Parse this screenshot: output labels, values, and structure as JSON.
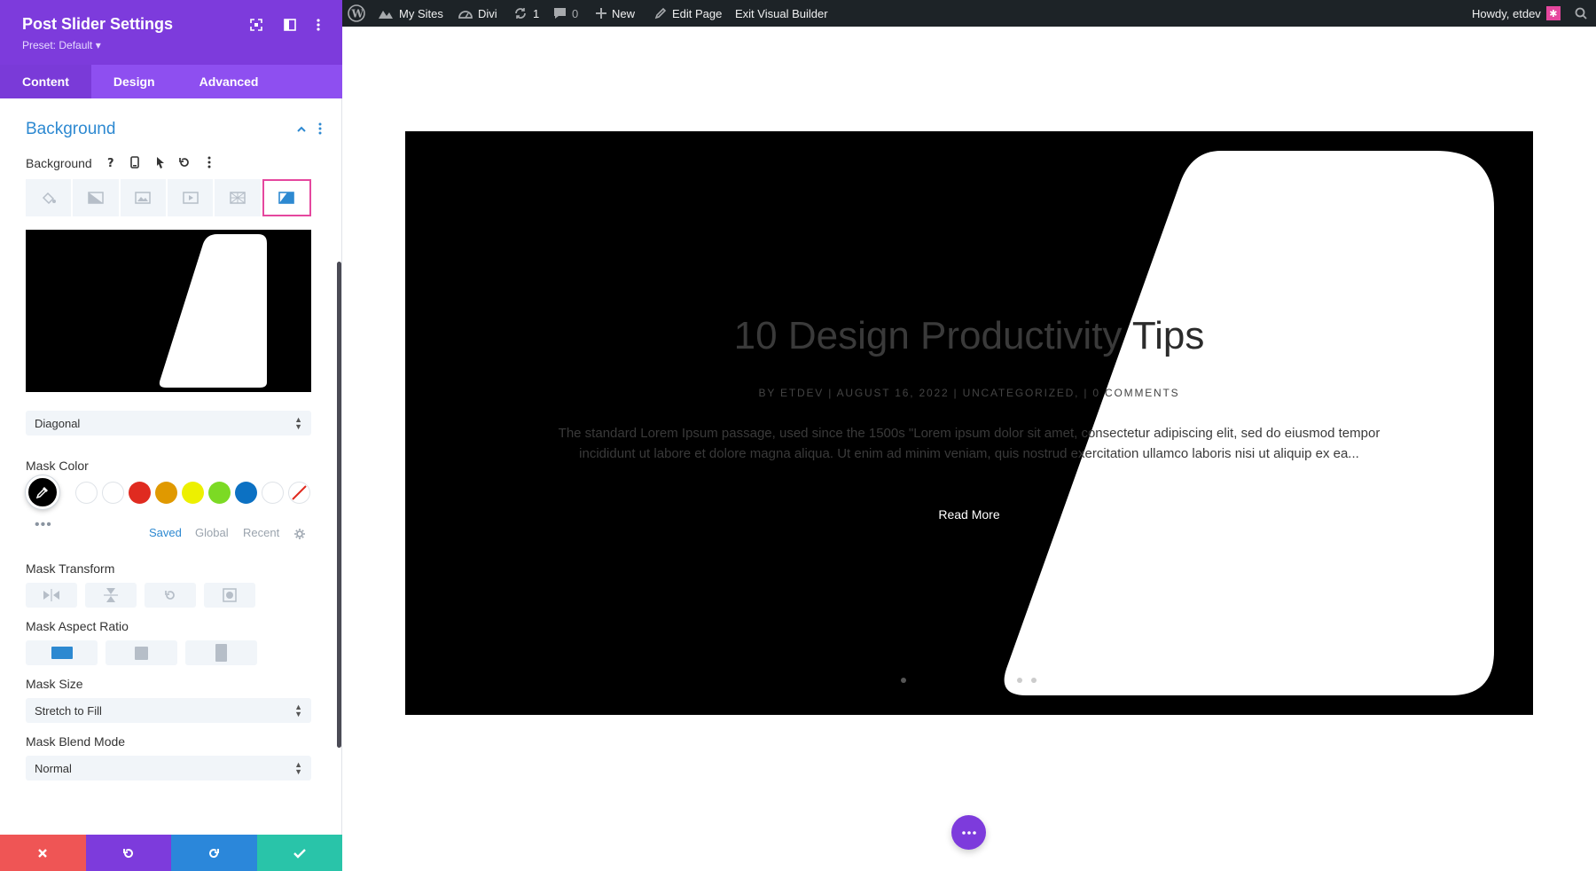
{
  "panel": {
    "title": "Post Slider Settings",
    "preset": "Preset: Default ▾",
    "tabs": [
      {
        "label": "Content",
        "active": true
      },
      {
        "label": "Design",
        "active": false
      },
      {
        "label": "Advanced",
        "active": false
      }
    ]
  },
  "background_section": {
    "title": "Background",
    "field_label": "Background",
    "selected_type": "mask",
    "mask_style": "Diagonal",
    "mask_color_label": "Mask Color",
    "mask_color": "#000000",
    "swatches": [
      "#ffffff",
      "#ffffff",
      "#e02b20",
      "#e09900",
      "#edf000",
      "#7cda24",
      "#0c71c3",
      "#ffffff"
    ],
    "palette_tabs": [
      "Saved",
      "Global",
      "Recent"
    ],
    "mask_transform_label": "Mask Transform",
    "mask_aspect_ratio_label": "Mask Aspect Ratio",
    "mask_size_label": "Mask Size",
    "mask_size": "Stretch to Fill",
    "mask_blend_label": "Mask Blend Mode",
    "mask_blend": "Normal"
  },
  "colors": {
    "accent_purple": "#7d3bdc",
    "accent_blue": "#2d89d1",
    "highlight_pink": "#e5479e",
    "footer_cancel": "#ef5555",
    "footer_undo": "#7d3bdc",
    "footer_redo": "#2b87da",
    "footer_save": "#29c4a9"
  },
  "adminbar": {
    "my_sites": "My Sites",
    "divi": "Divi",
    "updates": "1",
    "comments": "0",
    "new": "New",
    "edit_page": "Edit Page",
    "exit_vb": "Exit Visual Builder",
    "howdy": "Howdy, etdev"
  },
  "slide": {
    "title_part1": "10 Design Productivity",
    "title_part2": " Tips",
    "meta": "BY ETDEV | AUGUST 16, 2022 | UNCATEGORIZED, | 0 COMMENTS",
    "excerpt": "The standard Lorem Ipsum passage, used since the 1500s \"Lorem ipsum dolor sit amet, consectetur adipiscing elit, sed do eiusmod tempor incididunt ut labore et dolore magna aliqua. Ut enim ad minim veniam, quis nostrud exercitation ullamco laboris nisi ut aliquip ex ea...",
    "read_more": "Read More"
  }
}
